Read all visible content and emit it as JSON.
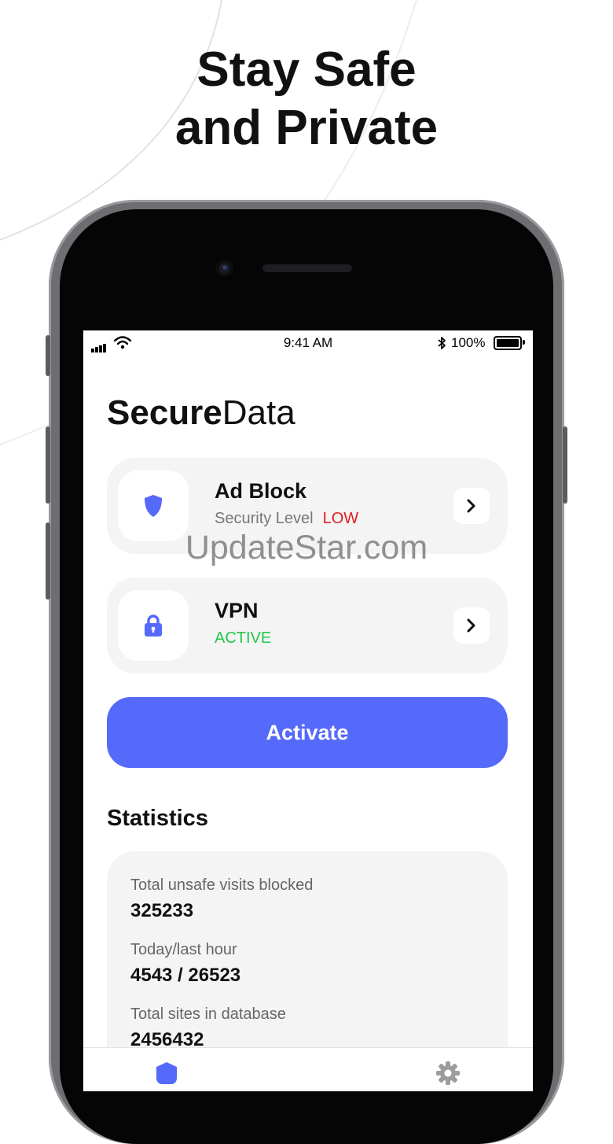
{
  "headline": {
    "line1": "Stay Safe",
    "line2": "and Private"
  },
  "status_bar": {
    "time": "9:41 AM",
    "battery": "100%"
  },
  "app": {
    "brand_bold": "Secure",
    "brand_regular": "Data"
  },
  "cards": [
    {
      "title": "Ad Block",
      "subtitle": "Security Level",
      "status": "LOW",
      "status_color": "#e11d1d",
      "icon": "shield-icon"
    },
    {
      "title": "VPN",
      "status": "ACTIVE",
      "status_color": "#22c94a",
      "icon": "lock-icon"
    }
  ],
  "activate_label": "Activate",
  "statistics": {
    "title": "Statistics",
    "items": [
      {
        "label": "Total unsafe visits blocked",
        "value": "325233"
      },
      {
        "label": "Today/last hour",
        "value": "4543 / 26523"
      },
      {
        "label": "Total sites in database",
        "value": "2456432"
      }
    ]
  },
  "tabs": [
    {
      "icon": "shield-icon",
      "active": true
    },
    {
      "icon": "gear-icon",
      "active": false
    }
  ],
  "watermark": "UpdateStar.com",
  "colors": {
    "accent": "#5569fb",
    "card_bg": "#f4f4f4",
    "phone_frame": "#6e6e72"
  }
}
